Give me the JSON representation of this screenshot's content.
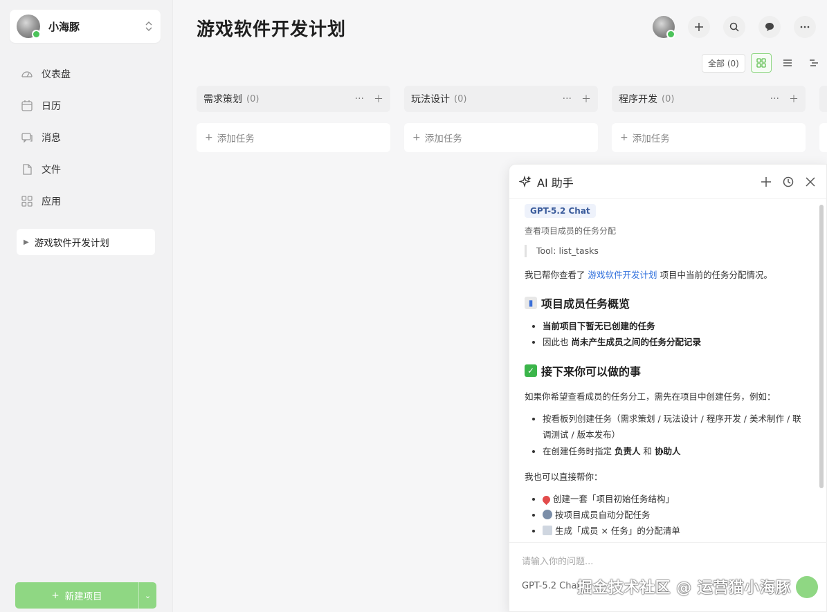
{
  "user": {
    "name": "小海豚"
  },
  "nav": [
    {
      "label": "仪表盘",
      "icon": "dashboard-icon"
    },
    {
      "label": "日历",
      "icon": "calendar-icon"
    },
    {
      "label": "消息",
      "icon": "message-icon"
    },
    {
      "label": "文件",
      "icon": "file-icon"
    },
    {
      "label": "应用",
      "icon": "apps-icon"
    }
  ],
  "project": {
    "name": "游戏软件开发计划"
  },
  "new_project": {
    "label": "新建项目"
  },
  "page": {
    "title": "游戏软件开发计划"
  },
  "filter": {
    "all_label": "全部 (0)"
  },
  "columns": [
    {
      "title": "需求策划",
      "count": "(0)",
      "add_label": "添加任务"
    },
    {
      "title": "玩法设计",
      "count": "(0)",
      "add_label": "添加任务"
    },
    {
      "title": "程序开发",
      "count": "(0)",
      "add_label": "添加任务"
    }
  ],
  "ai": {
    "title": "AI 助手",
    "model_tag": "GPT-5.2 Chat",
    "query": "查看项目成员的任务分配",
    "tool": "Tool: list_tasks",
    "intro_a": "我已帮你查看了",
    "intro_link": "游戏软件开发计划",
    "intro_b": "项目中当前的任务分配情况。",
    "h_overview": "项目成员任务概览",
    "overview_items": [
      "当前项目下暂无已创建的任务",
      "因此也",
      "尚未产生成员之间的任务分配记录"
    ],
    "h_next": "接下来你可以做的事",
    "next_para": "如果你希望查看成员的任务分工，需先在项目中创建任务，例如：",
    "next_items": [
      "按看板列创建任务（需求策划 / 玩法设计 / 程序开发 / 美术制作 / 联调测试 / 版本发布）",
      "在创建任务时指定",
      "负责人",
      "和",
      "协助人"
    ],
    "help_para": "我也可以直接帮你：",
    "help_items": [
      "创建一套「项目初始任务结构」",
      "按项目成员自动分配任务",
      "生成「成员 × 任务」的分配清单"
    ],
    "input_placeholder": "请输入你的问题...",
    "model_footer": "GPT-5.2 Chat"
  },
  "watermark": "掘金技术社区 @ 运营猫小海豚"
}
